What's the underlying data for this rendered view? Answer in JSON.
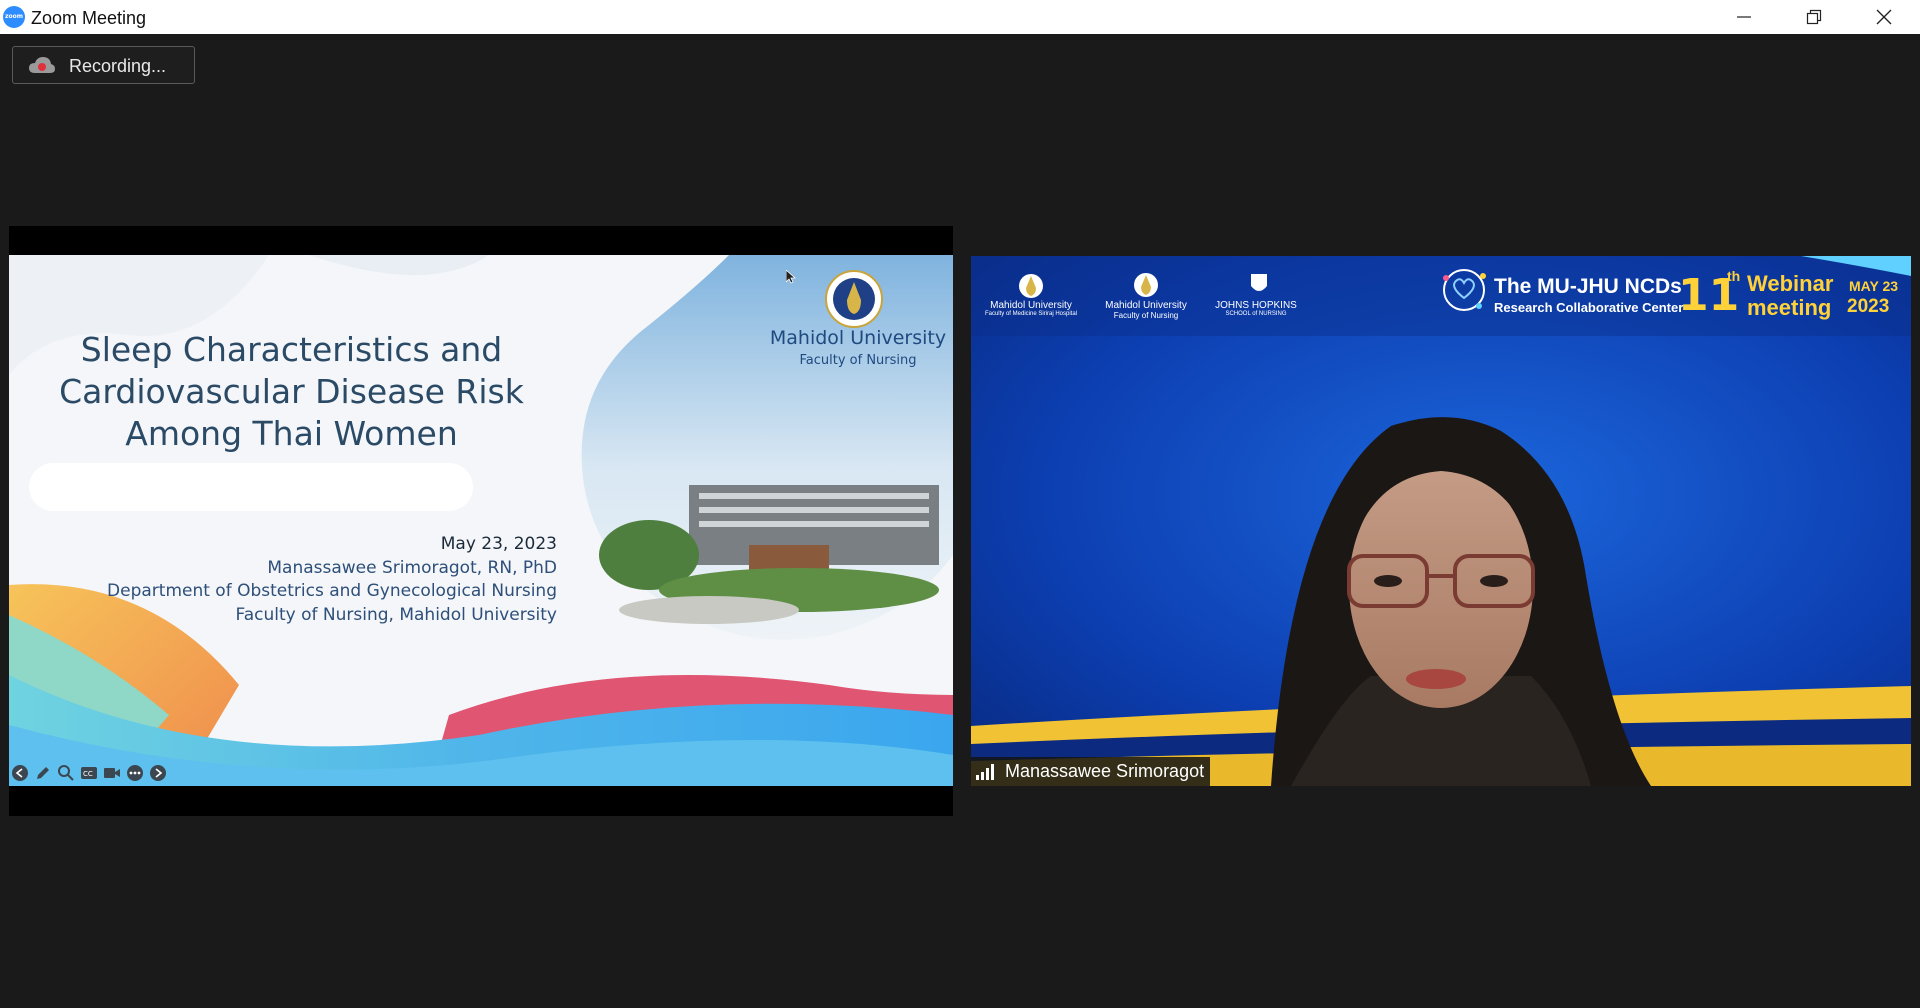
{
  "window": {
    "app_icon_label": "zoom",
    "title": "Zoom Meeting",
    "controls": [
      "minimize-icon",
      "restore-icon",
      "close-icon"
    ]
  },
  "recording": {
    "label": "Recording..."
  },
  "shared_slide": {
    "title": "Sleep Characteristics and Cardiovascular Disease Risk Among Thai Women",
    "title_lines": [
      "Sleep Characteristics and",
      "Cardiovascular Disease Risk",
      "Among Thai Women"
    ],
    "date": "May 23, 2023",
    "presenter": "Manassawee Srimoragot, RN, PhD",
    "department": "Department of Obstetrics and Gynecological Nursing",
    "faculty": "Faculty of Nursing, Mahidol University",
    "university_name": "Mahidol University",
    "university_sub": "Faculty of Nursing",
    "controls": [
      "back-icon",
      "pen-icon",
      "zoom-icon",
      "captions-icon",
      "video-icon",
      "more-icon",
      "forward-icon"
    ]
  },
  "video_tile": {
    "participant_name": "Manassawee Srimoragot",
    "banner": {
      "logos": [
        {
          "line1": "Mahidol University",
          "line2": "Faculty of Medicine Siriraj Hospital"
        },
        {
          "line1": "Mahidol University",
          "line2": "Faculty of Nursing"
        },
        {
          "line1": "JOHNS HOPKINS",
          "line2": "SCHOOL of NURSING"
        }
      ],
      "title": "The MU-JHU NCDs",
      "subtitle": "Research Collaborative Center",
      "edition": "11",
      "edition_suffix": "th",
      "event_line1": "Webinar",
      "event_line2": "meeting",
      "date_month_day": "MAY 23",
      "date_year": "2023"
    }
  },
  "colors": {
    "background": "#1a1a1a",
    "banner_blue": "#0c3aa8",
    "banner_yellow": "#ffd23a",
    "slide_title": "#2b4a66"
  }
}
